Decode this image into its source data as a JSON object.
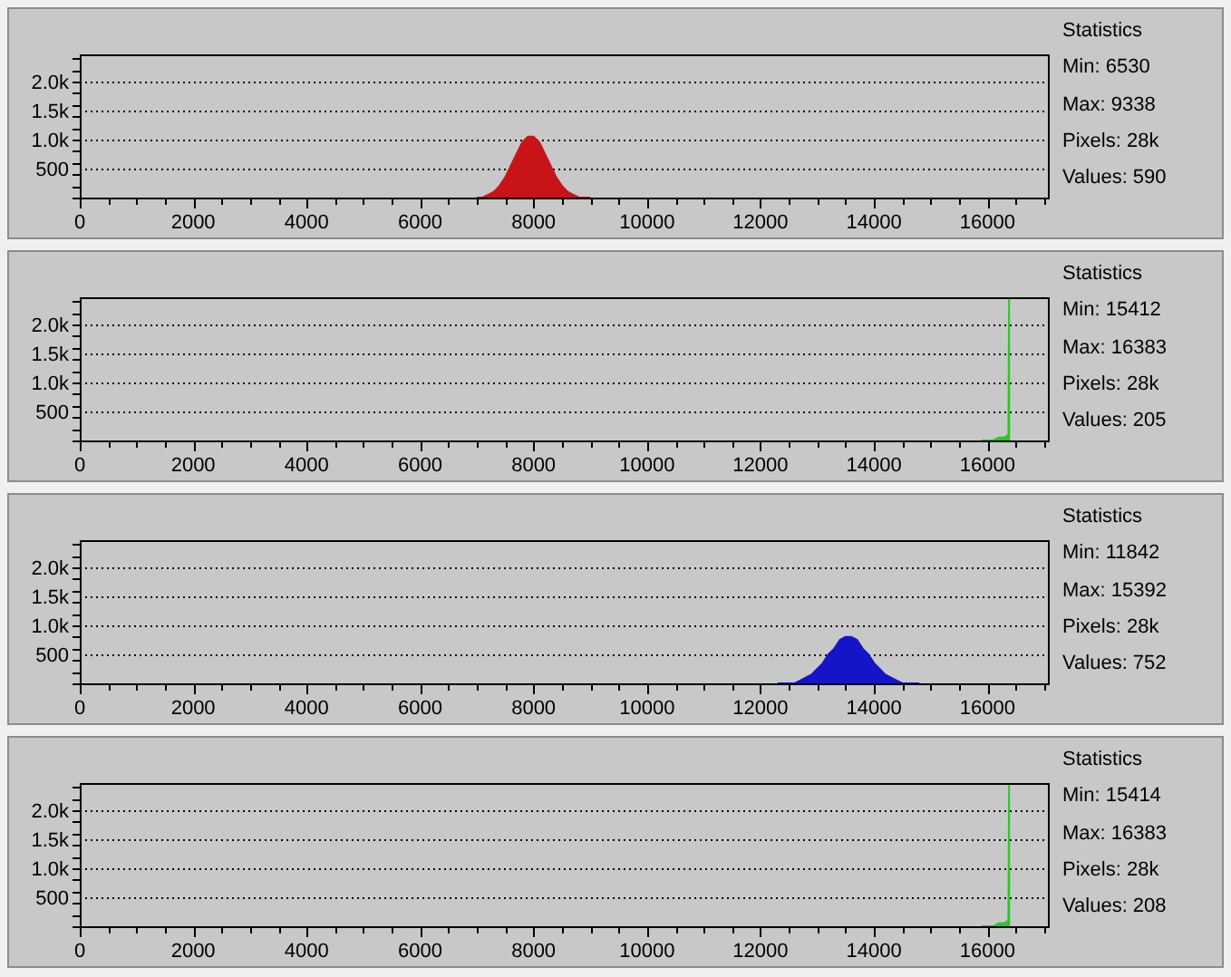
{
  "panels": [
    {
      "chart_data": {
        "type": "area",
        "grid": true,
        "xlim": [
          0,
          17066
        ],
        "ylim": [
          0,
          2470
        ],
        "xticks": [
          0,
          2000,
          4000,
          6000,
          8000,
          10000,
          12000,
          14000,
          16000
        ],
        "yticks": [
          {
            "value": 500,
            "label": "500"
          },
          {
            "value": 1000,
            "label": "1.0k"
          },
          {
            "value": 1500,
            "label": "1.5k"
          },
          {
            "value": 2000,
            "label": "2.0k"
          }
        ],
        "x": [
          7000,
          7100,
          7200,
          7300,
          7400,
          7500,
          7600,
          7700,
          7800,
          7900,
          8000,
          8100,
          8200,
          8300,
          8400,
          8500,
          8600,
          8700,
          8800,
          8900,
          9000
        ],
        "series": [
          {
            "color": "#c81418",
            "values": [
              0,
              0,
              50,
              100,
              200,
              350,
              550,
              750,
              950,
              1050,
              1050,
              950,
              750,
              550,
              350,
              200,
              100,
              50,
              0,
              0,
              0
            ]
          }
        ]
      },
      "statistics": {
        "title": "Statistics",
        "lines": [
          "Min: 6530",
          "Max: 9338",
          "Pixels: 28k",
          "Values: 590"
        ]
      }
    },
    {
      "chart_data": {
        "type": "area",
        "grid": true,
        "xlim": [
          0,
          17066
        ],
        "ylim": [
          0,
          2470
        ],
        "xticks": [
          0,
          2000,
          4000,
          6000,
          8000,
          10000,
          12000,
          14000,
          16000
        ],
        "yticks": [
          {
            "value": 500,
            "label": "500"
          },
          {
            "value": 1000,
            "label": "1.0k"
          },
          {
            "value": 1500,
            "label": "1.5k"
          },
          {
            "value": 2000,
            "label": "2.0k"
          }
        ],
        "x": [
          15900,
          16000,
          16100,
          16200,
          16300,
          16370,
          16383,
          16384
        ],
        "series": [
          {
            "color": "#22cc22",
            "values": [
              0,
              0,
              0,
              50,
              50,
              100,
              2470,
              0
            ]
          }
        ]
      },
      "statistics": {
        "title": "Statistics",
        "lines": [
          "Min: 15412",
          "Max: 16383",
          "Pixels: 28k",
          "Values: 205"
        ]
      }
    },
    {
      "chart_data": {
        "type": "area",
        "grid": true,
        "xlim": [
          0,
          17066
        ],
        "ylim": [
          0,
          2470
        ],
        "xticks": [
          0,
          2000,
          4000,
          6000,
          8000,
          10000,
          12000,
          14000,
          16000
        ],
        "yticks": [
          {
            "value": 500,
            "label": "500"
          },
          {
            "value": 1000,
            "label": "1.0k"
          },
          {
            "value": 1500,
            "label": "1.5k"
          },
          {
            "value": 2000,
            "label": "2.0k"
          }
        ],
        "x": [
          12300,
          12400,
          12500,
          12600,
          12700,
          12800,
          12900,
          13000,
          13100,
          13200,
          13300,
          13400,
          13500,
          13600,
          13700,
          13800,
          13900,
          14000,
          14100,
          14200,
          14300,
          14400,
          14500,
          14600,
          14700,
          14800
        ],
        "series": [
          {
            "color": "#1414c8",
            "values": [
              0,
              0,
              0,
              0,
              50,
              100,
              150,
              250,
              350,
              500,
              600,
              750,
              800,
              800,
              750,
              600,
              500,
              350,
              250,
              150,
              100,
              50,
              0,
              0,
              0,
              0
            ]
          }
        ]
      },
      "statistics": {
        "title": "Statistics",
        "lines": [
          "Min: 11842",
          "Max: 15392",
          "Pixels: 28k",
          "Values: 752"
        ]
      }
    },
    {
      "chart_data": {
        "type": "area",
        "grid": true,
        "xlim": [
          0,
          17066
        ],
        "ylim": [
          0,
          2470
        ],
        "xticks": [
          0,
          2000,
          4000,
          6000,
          8000,
          10000,
          12000,
          14000,
          16000
        ],
        "yticks": [
          {
            "value": 500,
            "label": "500"
          },
          {
            "value": 1000,
            "label": "1.0k"
          },
          {
            "value": 1500,
            "label": "1.5k"
          },
          {
            "value": 2000,
            "label": "2.0k"
          }
        ],
        "x": [
          15900,
          16000,
          16100,
          16200,
          16300,
          16370,
          16383,
          16384
        ],
        "series": [
          {
            "color": "#22cc22",
            "values": [
              0,
              0,
              0,
              50,
              50,
              100,
              2470,
              0
            ]
          }
        ]
      },
      "statistics": {
        "title": "Statistics",
        "lines": [
          "Min: 15414",
          "Max: 16383",
          "Pixels: 28k",
          "Values: 208"
        ]
      }
    }
  ]
}
